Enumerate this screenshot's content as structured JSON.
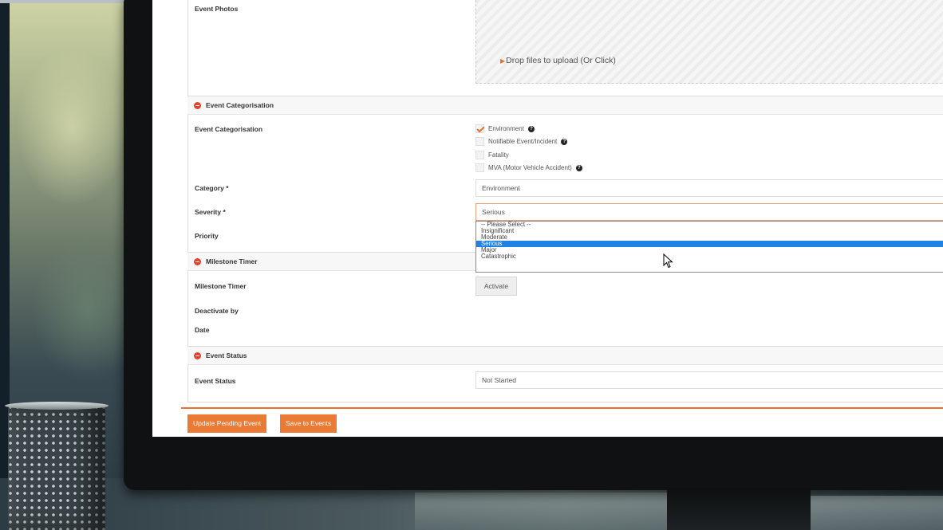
{
  "form": {
    "event_photos_label": "Event Photos",
    "dropzone_text": "Drop files to upload (Or Click)",
    "categorisation_section": {
      "title": "Event Categorisation",
      "field_label": "Event Categorisation",
      "options": [
        {
          "label": "Environment",
          "checked": true,
          "help": true
        },
        {
          "label": "Notifiable Event/Incident",
          "checked": false,
          "help": true
        },
        {
          "label": "Fatality",
          "checked": false,
          "help": false
        },
        {
          "label": "MVA (Motor Vehicle Accident)",
          "checked": false,
          "help": true
        }
      ],
      "category_label": "Category *",
      "category_value": "Environment",
      "severity_label": "Severity *",
      "severity_value": "Serious",
      "severity_options": [
        "-- Please Select --",
        "Insignificant",
        "Moderate",
        "Serious",
        "Major",
        "Catastrophic"
      ],
      "severity_selected": "Serious",
      "priority_label": "Priority"
    },
    "milestone_section": {
      "title": "Milestone Timer",
      "timer_label": "Milestone Timer",
      "activate_button": "Activate",
      "deactivate_label": "Deactivate by",
      "date_label": "Date"
    },
    "status_section": {
      "title": "Event Status",
      "status_label": "Event Status",
      "status_value": "Not Started"
    }
  },
  "actions": {
    "update_button": "Update Pending Event",
    "save_button": "Save to Events"
  },
  "colors": {
    "accent": "#ea7a34",
    "section_icon": "#e2422e",
    "selected_option": "#1e82e6"
  }
}
